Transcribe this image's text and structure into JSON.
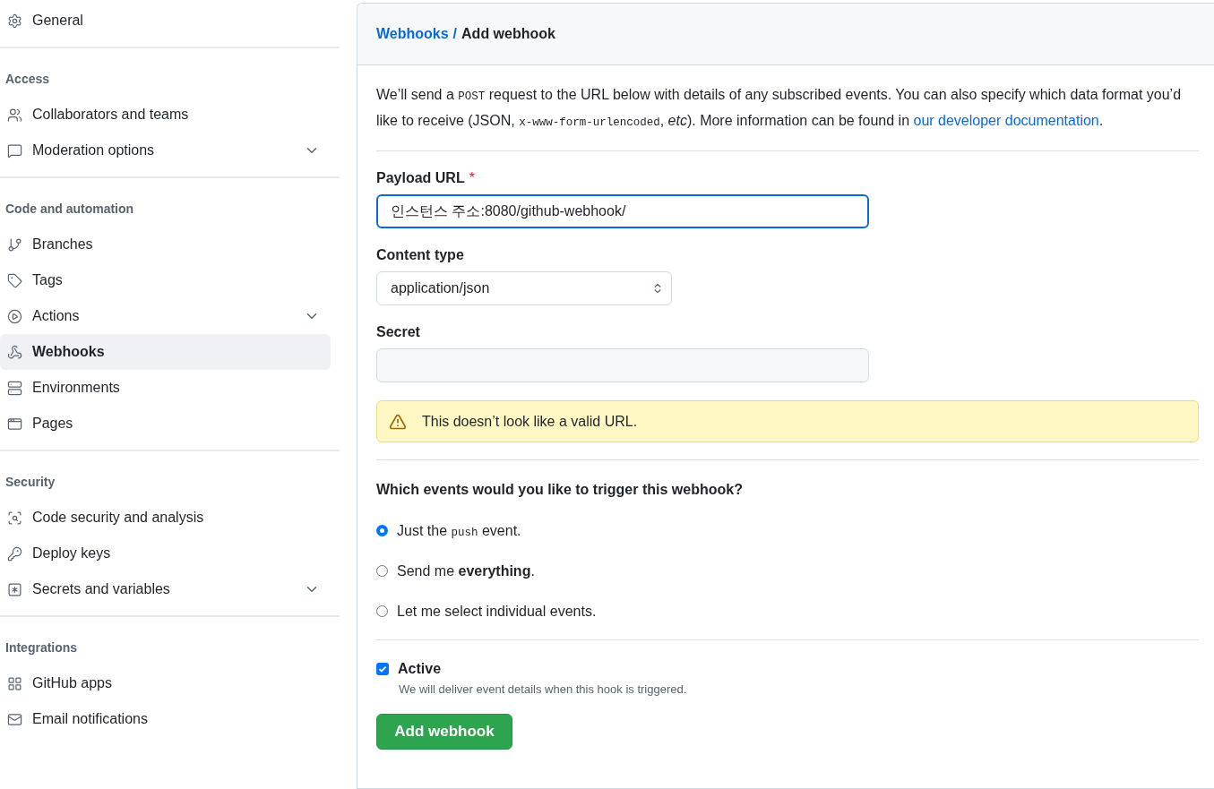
{
  "sidebar": {
    "sections": [
      {
        "items": [
          {
            "label": "General",
            "selected": false,
            "expandable": false
          }
        ]
      },
      {
        "heading": "Access",
        "items": [
          {
            "label": "Collaborators and teams",
            "selected": false,
            "expandable": false
          },
          {
            "label": "Moderation options",
            "selected": false,
            "expandable": true
          }
        ]
      },
      {
        "heading": "Code and automation",
        "items": [
          {
            "label": "Branches",
            "selected": false,
            "expandable": false
          },
          {
            "label": "Tags",
            "selected": false,
            "expandable": false
          },
          {
            "label": "Actions",
            "selected": false,
            "expandable": true
          },
          {
            "label": "Webhooks",
            "selected": true,
            "expandable": false
          },
          {
            "label": "Environments",
            "selected": false,
            "expandable": false
          },
          {
            "label": "Pages",
            "selected": false,
            "expandable": false
          }
        ]
      },
      {
        "heading": "Security",
        "items": [
          {
            "label": "Code security and analysis",
            "selected": false,
            "expandable": false
          },
          {
            "label": "Deploy keys",
            "selected": false,
            "expandable": false
          },
          {
            "label": "Secrets and variables",
            "selected": false,
            "expandable": true
          }
        ]
      },
      {
        "heading": "Integrations",
        "items": [
          {
            "label": "GitHub apps",
            "selected": false,
            "expandable": false
          },
          {
            "label": "Email notifications",
            "selected": false,
            "expandable": false
          }
        ]
      }
    ]
  },
  "breadcrumb": {
    "parent": "Webhooks",
    "separator": "/",
    "current": "Add webhook"
  },
  "description": [
    {
      "kind": "text",
      "text": "We’ll send a "
    },
    {
      "kind": "code",
      "text": "POST"
    },
    {
      "kind": "text",
      "text": " request to the URL below with details of any subscribed events. You can also specify which data format you’d like to receive (JSON, "
    },
    {
      "kind": "code",
      "text": "x-www-form-urlencoded"
    },
    {
      "kind": "text",
      "text": ", "
    },
    {
      "kind": "italic",
      "text": "etc"
    },
    {
      "kind": "text",
      "text": "). More information can be found in "
    },
    {
      "kind": "link",
      "text": "our developer documentation"
    },
    {
      "kind": "text",
      "text": "."
    }
  ],
  "payload_url": {
    "label": "Payload URL",
    "required_mark": "*",
    "value": "인스턴스 주소:8080/github-webhook/",
    "focused": true
  },
  "content_type": {
    "label": "Content type",
    "value": "application/json"
  },
  "secret": {
    "label": "Secret"
  },
  "warning": {
    "text": "This doesn’t look like a valid URL."
  },
  "events": {
    "question": "Which events would you like to trigger this webhook?",
    "options": [
      {
        "selected": true,
        "parts": [
          {
            "kind": "text",
            "text": "Just the "
          },
          {
            "kind": "code",
            "text": "push"
          },
          {
            "kind": "text",
            "text": " event."
          }
        ]
      },
      {
        "selected": false,
        "parts": [
          {
            "kind": "text",
            "text": "Send me "
          },
          {
            "kind": "bold",
            "text": "everything"
          },
          {
            "kind": "text",
            "text": "."
          }
        ]
      },
      {
        "selected": false,
        "parts": [
          {
            "kind": "text",
            "text": "Let me select individual events."
          }
        ]
      }
    ]
  },
  "active": {
    "label": "Active",
    "checked": true,
    "hint": "We will deliver event details when this hook is triggered."
  },
  "submit": {
    "label": "Add webhook"
  }
}
